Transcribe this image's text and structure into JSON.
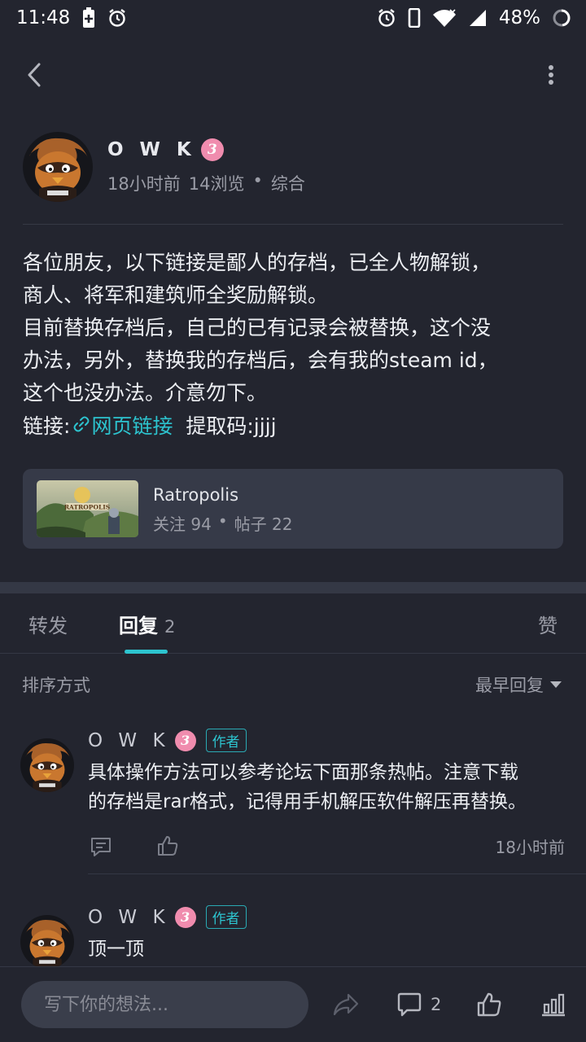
{
  "status_bar": {
    "time": "11:48",
    "battery": "48%"
  },
  "post": {
    "author": "O W K",
    "level": "3",
    "time_ago": "18小时前",
    "views": "14浏览",
    "category": "综合",
    "lines": [
      "各位朋友，以下链接是鄙人的存档，已全人物解锁，",
      "商人、将军和建筑师全奖励解锁。",
      "目前替换存档后，自己的已有记录会被替换，这个没",
      "办法，另外，替换我的存档后，会有我的steam id，",
      "这个也没办法。介意勿下。"
    ],
    "link_prefix": "链接:",
    "link_text": "网页链接",
    "extract_code": "提取码:jjjj"
  },
  "game_card": {
    "name": "Ratropolis",
    "followers": "关注 94",
    "posts": "帖子 22",
    "thumb_text": "RATROPOLIS"
  },
  "tabs": {
    "repost": "转发",
    "reply": "回复",
    "reply_count": "2",
    "like": "赞"
  },
  "sort": {
    "label": "排序方式",
    "selected": "最早回复"
  },
  "comments": [
    {
      "author": "O W K",
      "level": "3",
      "tag": "作者",
      "lines": [
        "具体操作方法可以参考论坛下面那条热帖。注意下载",
        "的存档是rar格式，记得用手机解压软件解压再替换。"
      ],
      "time": "18小时前"
    },
    {
      "author": "O W K",
      "level": "3",
      "tag": "作者",
      "lines": [
        "顶一顶"
      ]
    }
  ],
  "bottom_bar": {
    "placeholder": "写下你的想法...",
    "comment_count": "2"
  },
  "colors": {
    "background": "#23252f",
    "accent": "#2dc4cf",
    "level_badge": "#f08cae",
    "card": "#363a48"
  }
}
